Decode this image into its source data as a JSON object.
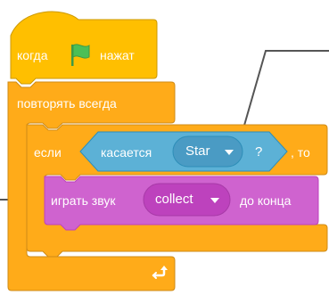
{
  "script": {
    "hat_block": {
      "label_before": "когда",
      "icon": "green-flag-icon",
      "label_after": "нажат"
    },
    "forever_block": {
      "label": "повторять всегда",
      "loop_icon": "loop-arrow-icon"
    },
    "if_block": {
      "label_if": "если",
      "label_then": ", то",
      "condition": {
        "label": "касается",
        "dropdown_value": "Star",
        "suffix": "?"
      }
    },
    "sound_block": {
      "label_before": "играть звук",
      "dropdown_value": "collect",
      "label_after": "до конца"
    }
  },
  "colors": {
    "control": "#FFAB19",
    "control_border": "#CF8B17",
    "events": "#FFBF00",
    "events_border": "#CC9900",
    "sensing": "#5CB1D6",
    "sensing_border": "#2E8EB8",
    "sound": "#CF63CF",
    "sound_border": "#BD42BD",
    "flag_green": "#4CBF56"
  }
}
